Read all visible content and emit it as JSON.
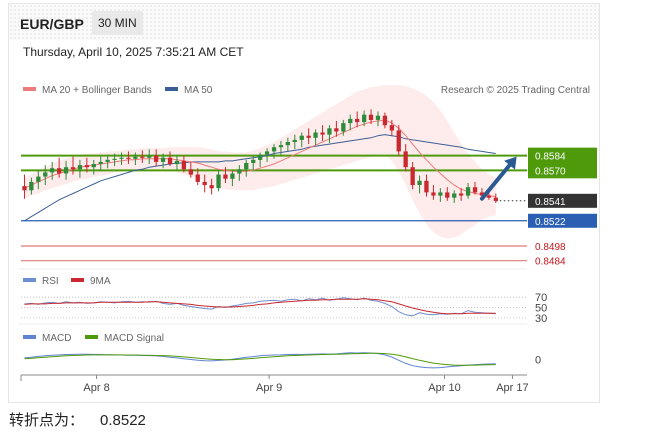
{
  "header": {
    "symbol": "EUR/GBP",
    "timeframe": "30 MIN",
    "datetime": "Thursday, April 10, 2025 7:35:21 AM CET"
  },
  "footer": {
    "label": "转折点为：",
    "value": "0.8522"
  },
  "colors": {
    "ma20": "#ee7b7b",
    "bands_fill": "#fde4e4",
    "ma50": "#3b5f95",
    "bull": "#2e8b3a",
    "bear": "#c9282e",
    "resistance": "#4f9a0b",
    "pivot": "#2a5fb4",
    "support": "#e07a7a",
    "last_tag": "#333333",
    "arrow": "#2b5a93",
    "rsi": "#6f8ed0",
    "rsi_ma": "#c9282e",
    "macd": "#5f84d2",
    "macd_signal": "#4f9a0b"
  },
  "chart_data": [
    {
      "type": "candlestick",
      "title": "",
      "credit": "Research © 2025 Trading Central",
      "legend": [
        {
          "name": "MA 20 + Bollinger Bands",
          "color": "#ee7b7b"
        },
        {
          "name": "MA 50",
          "color": "#3b5f95"
        }
      ],
      "legend_position": "top-left",
      "ylim": [
        0.8478,
        0.8636
      ],
      "x_ticks": [
        "Apr 8",
        "Apr 9",
        "Apr 10",
        "Apr 17"
      ],
      "x_tick_index": [
        10.4,
        35.3,
        60.6,
        70.4
      ],
      "x_range": [
        -0.5,
        72.5
      ],
      "candles": [
        [
          0.8555,
          0.8566,
          0.8543,
          0.8551
        ],
        [
          0.8551,
          0.8563,
          0.8547,
          0.8559
        ],
        [
          0.8559,
          0.857,
          0.8552,
          0.8564
        ],
        [
          0.8564,
          0.8575,
          0.8556,
          0.8568
        ],
        [
          0.8568,
          0.8578,
          0.8561,
          0.8572
        ],
        [
          0.8572,
          0.8582,
          0.8563,
          0.8567
        ],
        [
          0.8567,
          0.8579,
          0.8561,
          0.8573
        ],
        [
          0.8573,
          0.8583,
          0.8566,
          0.8571
        ],
        [
          0.8571,
          0.858,
          0.8563,
          0.8575
        ],
        [
          0.8575,
          0.8582,
          0.8568,
          0.8573
        ],
        [
          0.8573,
          0.858,
          0.8566,
          0.8576
        ],
        [
          0.8576,
          0.8584,
          0.8569,
          0.8578
        ],
        [
          0.8578,
          0.8585,
          0.8572,
          0.858
        ],
        [
          0.858,
          0.8586,
          0.8574,
          0.8581
        ],
        [
          0.8581,
          0.8587,
          0.8575,
          0.8582
        ],
        [
          0.8582,
          0.8588,
          0.8576,
          0.8581
        ],
        [
          0.8581,
          0.8587,
          0.8575,
          0.8583
        ],
        [
          0.8583,
          0.8589,
          0.8577,
          0.8582
        ],
        [
          0.8582,
          0.859,
          0.8576,
          0.8584
        ],
        [
          0.8584,
          0.859,
          0.8574,
          0.8578
        ],
        [
          0.8578,
          0.8586,
          0.8572,
          0.8582
        ],
        [
          0.8582,
          0.8588,
          0.8574,
          0.8576
        ],
        [
          0.8576,
          0.8584,
          0.857,
          0.8579
        ],
        [
          0.8579,
          0.8584,
          0.8568,
          0.8571
        ],
        [
          0.8571,
          0.8578,
          0.8563,
          0.8566
        ],
        [
          0.8566,
          0.8572,
          0.8556,
          0.8559
        ],
        [
          0.8559,
          0.8566,
          0.8549,
          0.8556
        ],
        [
          0.8556,
          0.8562,
          0.8547,
          0.8553
        ],
        [
          0.8553,
          0.857,
          0.855,
          0.8566
        ],
        [
          0.8566,
          0.8573,
          0.8558,
          0.8562
        ],
        [
          0.8562,
          0.857,
          0.8555,
          0.8567
        ],
        [
          0.8567,
          0.8575,
          0.856,
          0.8571
        ],
        [
          0.8571,
          0.858,
          0.8564,
          0.8577
        ],
        [
          0.8577,
          0.8584,
          0.857,
          0.858
        ],
        [
          0.858,
          0.8587,
          0.8573,
          0.8585
        ],
        [
          0.8585,
          0.8591,
          0.8578,
          0.8588
        ],
        [
          0.8588,
          0.8595,
          0.8581,
          0.8592
        ],
        [
          0.8592,
          0.8598,
          0.8584,
          0.8594
        ],
        [
          0.8594,
          0.8601,
          0.8588,
          0.8597
        ],
        [
          0.8597,
          0.8604,
          0.859,
          0.8599
        ],
        [
          0.8599,
          0.8606,
          0.8592,
          0.8603
        ],
        [
          0.8603,
          0.861,
          0.8595,
          0.8601
        ],
        [
          0.8601,
          0.8609,
          0.8594,
          0.8606
        ],
        [
          0.8606,
          0.8613,
          0.8598,
          0.8604
        ],
        [
          0.8604,
          0.8613,
          0.8596,
          0.861
        ],
        [
          0.861,
          0.8617,
          0.8602,
          0.8607
        ],
        [
          0.8607,
          0.8618,
          0.8603,
          0.8615
        ],
        [
          0.8615,
          0.8623,
          0.8608,
          0.8619
        ],
        [
          0.8619,
          0.8626,
          0.8611,
          0.8616
        ],
        [
          0.8616,
          0.8627,
          0.8612,
          0.8623
        ],
        [
          0.8623,
          0.8628,
          0.8614,
          0.8618
        ],
        [
          0.8618,
          0.8626,
          0.8612,
          0.8622
        ],
        [
          0.8622,
          0.8625,
          0.861,
          0.8613
        ],
        [
          0.8613,
          0.8618,
          0.8603,
          0.8608
        ],
        [
          0.8608,
          0.8613,
          0.8584,
          0.8588
        ],
        [
          0.8588,
          0.8595,
          0.8569,
          0.8573
        ],
        [
          0.8573,
          0.8578,
          0.8552,
          0.8556
        ],
        [
          0.8556,
          0.8565,
          0.8548,
          0.856
        ],
        [
          0.856,
          0.8566,
          0.8545,
          0.8549
        ],
        [
          0.8549,
          0.8556,
          0.8542,
          0.8546
        ],
        [
          0.8546,
          0.8553,
          0.854,
          0.8549
        ],
        [
          0.8549,
          0.8554,
          0.8541,
          0.8544
        ],
        [
          0.8544,
          0.8551,
          0.8539,
          0.8548
        ],
        [
          0.8548,
          0.8553,
          0.8541,
          0.8546
        ],
        [
          0.8546,
          0.8558,
          0.8543,
          0.8554
        ],
        [
          0.8554,
          0.8559,
          0.8547,
          0.8549
        ],
        [
          0.8549,
          0.8553,
          0.8543,
          0.8546
        ],
        [
          0.8546,
          0.8552,
          0.8542,
          0.8544
        ],
        [
          0.8544,
          0.8548,
          0.8539,
          0.8541
        ]
      ],
      "ma50": [
        0.8522,
        0.8526,
        0.853,
        0.8534,
        0.8538,
        0.8542,
        0.8545,
        0.8548,
        0.8551,
        0.8554,
        0.8557,
        0.856,
        0.8562,
        0.8564,
        0.8566,
        0.8568,
        0.857,
        0.8571,
        0.8573,
        0.8574,
        0.8575,
        0.8576,
        0.8577,
        0.8577,
        0.8578,
        0.8578,
        0.8578,
        0.8578,
        0.8578,
        0.8579,
        0.8579,
        0.858,
        0.8581,
        0.8582,
        0.8583,
        0.8584,
        0.8586,
        0.8587,
        0.8588,
        0.8589,
        0.859,
        0.8592,
        0.8593,
        0.8594,
        0.8595,
        0.8596,
        0.8597,
        0.8598,
        0.8599,
        0.86,
        0.8601,
        0.8603,
        0.8604,
        0.8603,
        0.8602,
        0.86,
        0.8599,
        0.8598,
        0.8597,
        0.8596,
        0.8595,
        0.8594,
        0.8593,
        0.8592,
        0.859,
        0.8589,
        0.8588,
        0.8587,
        0.8586
      ],
      "ma20": [
        0.8553,
        0.8556,
        0.8559,
        0.8562,
        0.8565,
        0.8567,
        0.8569,
        0.8571,
        0.8573,
        0.8574,
        0.8575,
        0.8576,
        0.8577,
        0.8578,
        0.8579,
        0.858,
        0.858,
        0.8581,
        0.8581,
        0.8581,
        0.8581,
        0.8581,
        0.858,
        0.8579,
        0.8578,
        0.8577,
        0.8575,
        0.8573,
        0.8571,
        0.857,
        0.8569,
        0.8569,
        0.8569,
        0.857,
        0.8572,
        0.8574,
        0.8576,
        0.8579,
        0.8582,
        0.8585,
        0.8588,
        0.8591,
        0.8594,
        0.8597,
        0.86,
        0.8603,
        0.8606,
        0.8609,
        0.8612,
        0.8614,
        0.8616,
        0.8617,
        0.8618,
        0.8615,
        0.861,
        0.8603,
        0.8595,
        0.8587,
        0.858,
        0.8573,
        0.8567,
        0.8561,
        0.8556,
        0.8552,
        0.855,
        0.8548,
        0.8547,
        0.8546,
        0.8545
      ],
      "bb_width": [
        0.001,
        0.001,
        0.0011,
        0.0011,
        0.0012,
        0.0012,
        0.0012,
        0.0012,
        0.0012,
        0.0012,
        0.0011,
        0.0011,
        0.0011,
        0.001,
        0.001,
        0.001,
        0.001,
        0.001,
        0.001,
        0.001,
        0.001,
        0.0011,
        0.0012,
        0.0013,
        0.0014,
        0.0015,
        0.0016,
        0.0017,
        0.0017,
        0.0018,
        0.0018,
        0.0018,
        0.0018,
        0.0019,
        0.0019,
        0.002,
        0.0021,
        0.0022,
        0.0023,
        0.0024,
        0.0025,
        0.0026,
        0.0027,
        0.0028,
        0.0029,
        0.003,
        0.0031,
        0.0032,
        0.0033,
        0.0033,
        0.0033,
        0.0033,
        0.0033,
        0.0036,
        0.0041,
        0.0047,
        0.0053,
        0.0058,
        0.0061,
        0.0062,
        0.006,
        0.0056,
        0.005,
        0.0043,
        0.0036,
        0.003,
        0.0024,
        0.002,
        0.0018
      ],
      "levels": [
        {
          "label": "0.8584",
          "value": 0.8584,
          "kind": "resistance"
        },
        {
          "label": "0.8570",
          "value": 0.857,
          "kind": "resistance"
        },
        {
          "label": "0.8541",
          "value": 0.8541,
          "kind": "last"
        },
        {
          "label": "0.8522",
          "value": 0.8522,
          "kind": "pivot"
        },
        {
          "label": "0.8498",
          "value": 0.8498,
          "kind": "support"
        },
        {
          "label": "0.8484",
          "value": 0.8484,
          "kind": "support"
        }
      ],
      "forecast_arrow": {
        "from": [
          66,
          0.8543
        ],
        "to": [
          71,
          0.8583
        ]
      }
    },
    {
      "type": "line",
      "name": "rsi_panel",
      "legend": [
        {
          "name": "RSI",
          "color": "#6f8ed0"
        },
        {
          "name": "9MA",
          "color": "#c9282e"
        }
      ],
      "ylim": [
        22,
        80
      ],
      "y_ticks": [
        "70",
        "50",
        "30"
      ],
      "y_tick_values": [
        70,
        50,
        30
      ],
      "rsi": [
        57,
        58,
        56,
        59,
        60,
        58,
        61,
        59,
        60,
        58,
        59,
        61,
        60,
        59,
        61,
        62,
        60,
        61,
        60,
        62,
        58,
        56,
        58,
        54,
        52,
        50,
        48,
        47,
        52,
        50,
        53,
        55,
        58,
        59,
        62,
        63,
        64,
        62,
        65,
        66,
        63,
        67,
        65,
        68,
        64,
        66,
        69,
        67,
        65,
        68,
        64,
        62,
        58,
        52,
        42,
        36,
        34,
        40,
        37,
        36,
        38,
        37,
        39,
        38,
        44,
        41,
        40,
        39,
        38
      ],
      "rsi_ma": [
        56,
        57,
        57,
        57,
        58,
        58,
        59,
        59,
        59,
        59,
        59,
        60,
        60,
        60,
        60,
        60,
        60,
        60,
        61,
        61,
        60,
        59,
        58,
        57,
        56,
        54,
        53,
        52,
        51,
        51,
        51,
        52,
        53,
        54,
        56,
        57,
        59,
        60,
        61,
        62,
        63,
        64,
        64,
        65,
        65,
        66,
        66,
        66,
        66,
        67,
        66,
        65,
        63,
        61,
        57,
        53,
        49,
        46,
        43,
        41,
        39,
        38,
        38,
        38,
        39,
        39,
        39,
        39,
        39
      ]
    },
    {
      "type": "line",
      "name": "macd_panel",
      "legend": [
        {
          "name": "MACD",
          "color": "#5f84d2"
        },
        {
          "name": "MACD Signal",
          "color": "#4f9a0b"
        }
      ],
      "ylim": [
        -0.001,
        0.001
      ],
      "y_ticks": [
        "0"
      ],
      "y_tick_values": [
        0
      ],
      "macd": [
        0.0001,
        0.00015,
        0.0002,
        0.00024,
        0.00027,
        0.0003,
        0.00032,
        0.00033,
        0.00034,
        0.00034,
        0.00033,
        0.00032,
        0.00031,
        0.0003,
        0.00029,
        0.00028,
        0.00027,
        0.00026,
        0.00025,
        0.00023,
        0.0002,
        0.00015,
        0.0001,
        5e-05,
        0.0,
        -5e-05,
        -8e-05,
        -9e-05,
        -6e-05,
        -3e-05,
        2e-05,
        8e-05,
        0.00014,
        0.00019,
        0.00024,
        0.00027,
        0.00029,
        0.0003,
        0.00032,
        0.00033,
        0.00032,
        0.00034,
        0.00035,
        0.00036,
        0.00035,
        0.00036,
        0.0004,
        0.00043,
        0.00042,
        0.00044,
        0.00042,
        0.00038,
        0.0003,
        0.00016,
        -5e-05,
        -0.00025,
        -0.0004,
        -0.00048,
        -0.00052,
        -0.00054,
        -0.00052,
        -0.00048,
        -0.00044,
        -0.0004,
        -0.00036,
        -0.00033,
        -0.00031,
        -0.00029,
        -0.00028
      ],
      "macd_signal": [
        5e-05,
        8e-05,
        0.00011,
        0.00015,
        0.00018,
        0.00021,
        0.00024,
        0.00026,
        0.00028,
        0.00029,
        0.0003,
        0.0003,
        0.0003,
        0.0003,
        0.0003,
        0.00029,
        0.00029,
        0.00028,
        0.00027,
        0.00026,
        0.00025,
        0.00023,
        0.0002,
        0.00017,
        0.00013,
        9e-05,
        5e-05,
        2e-05,
        0.0,
        -1e-05,
        -1e-05,
        1e-05,
        4e-05,
        7e-05,
        0.00011,
        0.00015,
        0.00018,
        0.00021,
        0.00024,
        0.00026,
        0.00028,
        0.00029,
        0.00031,
        0.00032,
        0.00033,
        0.00034,
        0.00035,
        0.00037,
        0.00038,
        0.00039,
        0.0004,
        0.0004,
        0.00038,
        0.00034,
        0.00027,
        0.00017,
        6e-05,
        -5e-05,
        -0.00015,
        -0.00023,
        -0.00029,
        -0.00033,
        -0.00036,
        -0.00037,
        -0.00037,
        -0.00036,
        -0.00035,
        -0.00034,
        -0.00033
      ]
    }
  ]
}
